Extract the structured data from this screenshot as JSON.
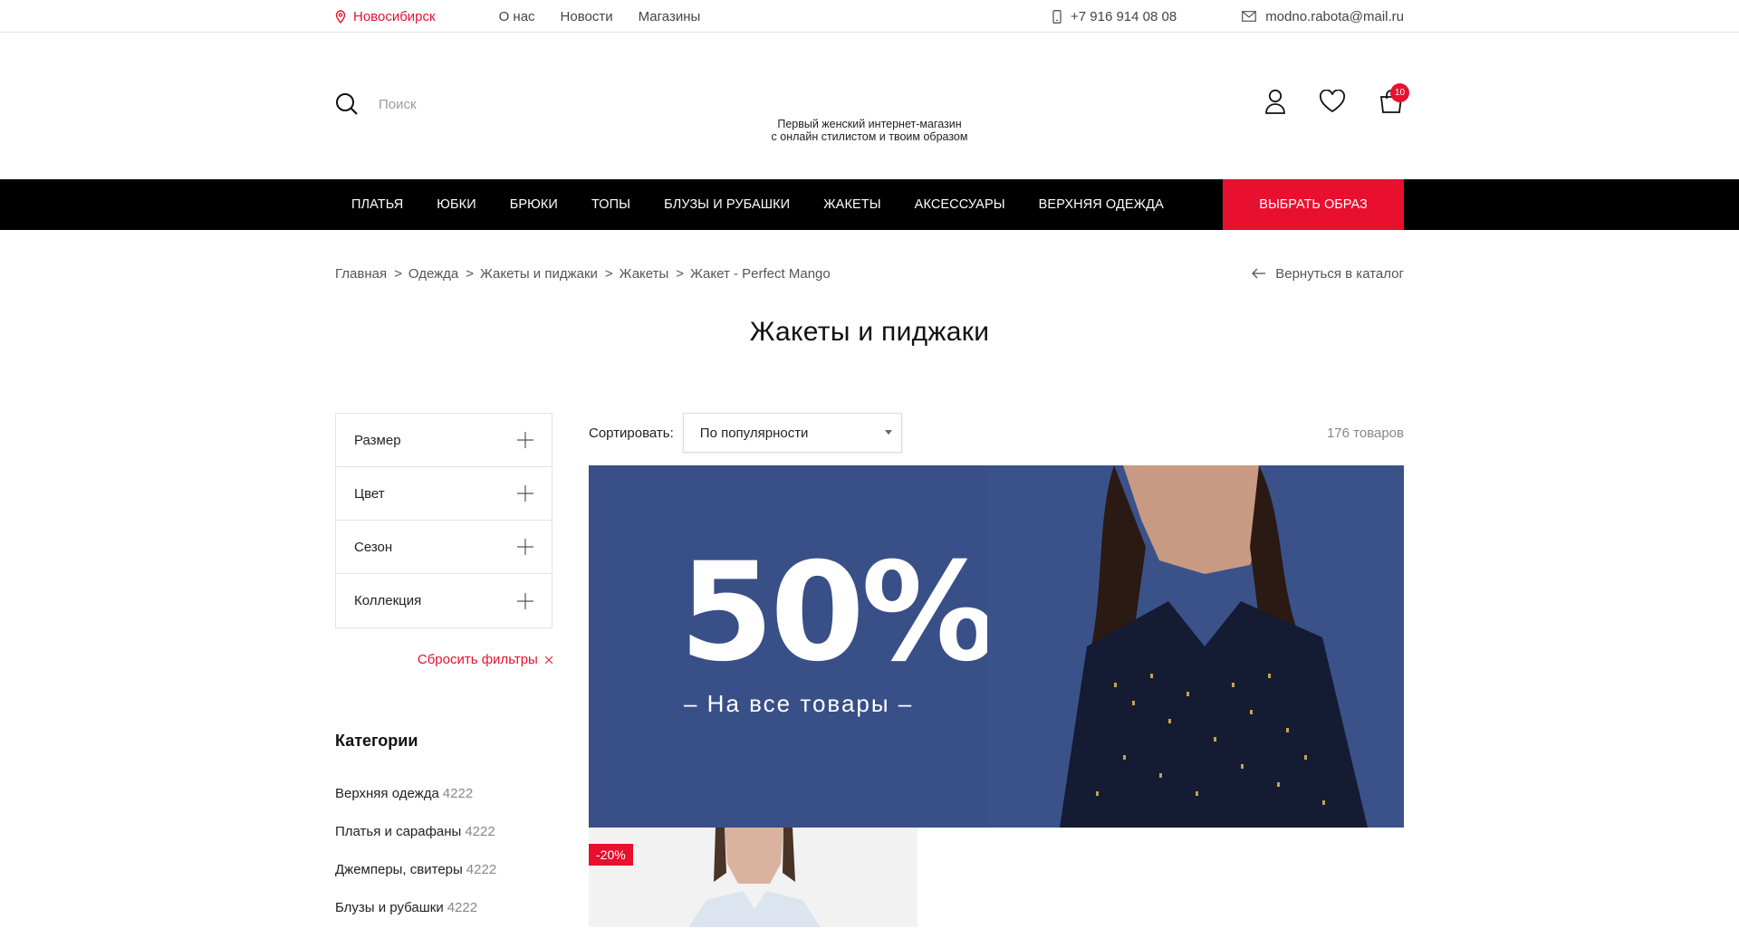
{
  "topbar": {
    "city": "Новосибирск",
    "nav": [
      "О нас",
      "Новости",
      "Магазины"
    ],
    "phone": "+7 916 914 08 08",
    "email": "modno.rabota@mail.ru"
  },
  "header": {
    "search_placeholder": "Поиск",
    "tagline_line1": "Первый женский интернет-магазин",
    "tagline_line2": "с онлайн стилистом и твоим образом",
    "cart_count": "10"
  },
  "main_nav": {
    "items": [
      "Платья",
      "Юбки",
      "Брюки",
      "Топы",
      "Блузы и рубашки",
      "Жакеты",
      "Аксессуары",
      "Верхняя одежда"
    ],
    "cta": "Выбрать образ"
  },
  "breadcrumbs": [
    "Главная",
    "Одежда",
    "Жакеты и пиджаки",
    "Жакеты",
    "Жакет - Perfect Mango"
  ],
  "breadcrumb_separator": ">",
  "back_link": "Вернуться в каталог",
  "page_title": "Жакеты и пиджаки",
  "filters": [
    "Размер",
    "Цвет",
    "Сезон",
    "Коллекция"
  ],
  "reset_filters": "Сбросить фильтры",
  "categories": {
    "title": "Категории",
    "items": [
      {
        "name": "Верхняя одежда",
        "count": "4222"
      },
      {
        "name": "Платья и сарафаны",
        "count": "4222"
      },
      {
        "name": "Джемперы, свитеры",
        "count": "4222"
      },
      {
        "name": "Блузы и рубашки",
        "count": "4222"
      }
    ]
  },
  "sort": {
    "label": "Сортировать:",
    "selected": "По популярности"
  },
  "product_count": "176 товаров",
  "banner": {
    "headline": "50%",
    "subline": "– На все товары –"
  },
  "product_card": {
    "discount": "-20%"
  },
  "colors": {
    "accent": "#e8102e",
    "nav_bg": "#000000",
    "banner_bg": "#384f87"
  }
}
